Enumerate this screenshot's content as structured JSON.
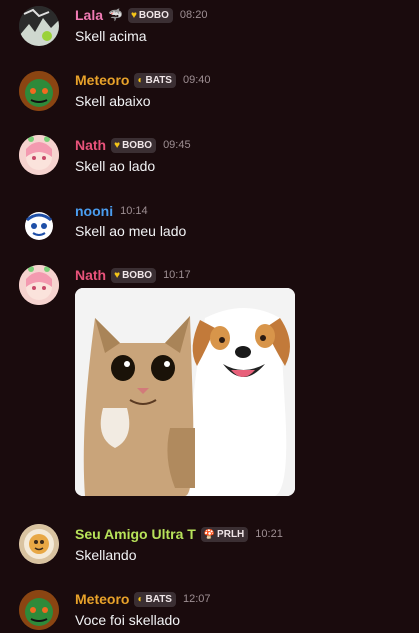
{
  "messages": [
    {
      "author": "Lala",
      "author_color": "#f07bb4",
      "emoji": "🦈",
      "badge": {
        "icon": "heart-icon",
        "icon_color": "#f5c518",
        "label": "BOBO"
      },
      "time": "08:20",
      "text": "Skell acima"
    },
    {
      "author": "Meteoro",
      "author_color": "#e8a22a",
      "badge": {
        "icon": "moon-icon",
        "icon_color": "#f5c518",
        "label": "BATS"
      },
      "time": "09:40",
      "text": "Skell abaixo"
    },
    {
      "author": "Nath",
      "author_color": "#e8537b",
      "badge": {
        "icon": "heart-icon",
        "icon_color": "#f5c518",
        "label": "BOBO"
      },
      "time": "09:45",
      "text": "Skell ao lado"
    },
    {
      "author": "nooni",
      "author_color": "#4a9df0",
      "time": "10:14",
      "text": "Skell ao meu lado"
    },
    {
      "author": "Nath",
      "author_color": "#e8537b",
      "badge": {
        "icon": "heart-icon",
        "icon_color": "#f5c518",
        "label": "BOBO"
      },
      "time": "10:17",
      "attachment": "cat-and-dog-image"
    },
    {
      "author": "Seu Amigo Ultra T",
      "author_color": "#b8e35a",
      "badge": {
        "icon": "mushroom-icon",
        "icon_color": "#ff5ba8",
        "label": "PRLH"
      },
      "time": "10:21",
      "text": "Skellando"
    },
    {
      "author": "Meteoro",
      "author_color": "#e8a22a",
      "badge": {
        "icon": "moon-icon",
        "icon_color": "#f5c518",
        "label": "BATS"
      },
      "time": "12:07",
      "text": "Voce foi skellado"
    }
  ],
  "icons": {
    "heart": "♥",
    "moon": "◐",
    "mushroom": "🍄"
  }
}
